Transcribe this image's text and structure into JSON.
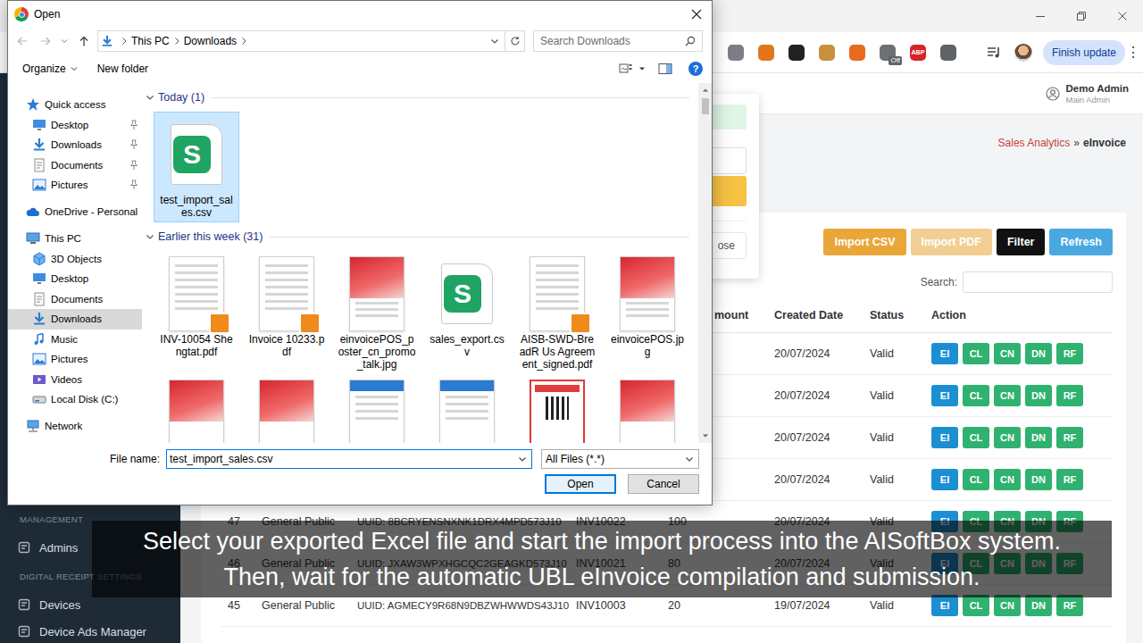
{
  "browser": {
    "extensions": [
      {
        "color": "#7b7f85"
      },
      {
        "color": "#e2761b"
      },
      {
        "color": "#222222"
      },
      {
        "color": "#c8913f"
      },
      {
        "color": "#e86a1d"
      },
      {
        "color": "#6d7075",
        "badge": "Off"
      },
      {
        "color": "#d8232a",
        "glyph": "ABP"
      },
      {
        "color": "#5f6368"
      }
    ],
    "update_button": "Finish update",
    "menu_glyph": "⋮"
  },
  "app": {
    "sidebar": {
      "items": [
        {
          "kind": "section",
          "label": "MANAGEMENT"
        },
        {
          "kind": "link",
          "label": "Admins"
        },
        {
          "kind": "section",
          "label": "DIGITAL RECEIPT SETTINGS"
        },
        {
          "kind": "link",
          "label": "Devices"
        },
        {
          "kind": "link",
          "label": "Device Ads Manager"
        }
      ]
    },
    "user": {
      "name": "Demo Admin",
      "role": "Main Admin"
    },
    "breadcrumb": {
      "parent": "Sales Analytics",
      "separator": "»",
      "current": "eInvoice"
    },
    "modal": {
      "close_label": "ose"
    },
    "actions": [
      {
        "label": "Import CSV",
        "disabled": false,
        "color": "#e9a73a"
      },
      {
        "label": "Import PDF",
        "disabled": true,
        "color": "#e9a73a"
      },
      {
        "label": "Filter",
        "disabled": false,
        "color": "#111111"
      },
      {
        "label": "Refresh",
        "disabled": false,
        "color": "#4aa8e0"
      }
    ],
    "search": {
      "label": "Search:",
      "value": ""
    },
    "table": {
      "columns": [
        "mount",
        "Created Date",
        "Status",
        "Action"
      ],
      "row_actions": [
        {
          "label": "EI",
          "color": "#1c8fd3"
        },
        {
          "label": "CL",
          "color": "#2fb170"
        },
        {
          "label": "CN",
          "color": "#2fb170"
        },
        {
          "label": "DN",
          "color": "#2fb170"
        },
        {
          "label": "RF",
          "color": "#2fb170"
        }
      ],
      "rows": [
        {
          "id": "",
          "customer": "",
          "uuid": "",
          "invoice": "",
          "amount": "",
          "date": "20/07/2024",
          "status": "Valid"
        },
        {
          "id": "",
          "customer": "",
          "uuid": "",
          "invoice": "",
          "amount": "",
          "date": "20/07/2024",
          "status": "Valid"
        },
        {
          "id": "",
          "customer": "",
          "uuid": "",
          "invoice": "",
          "amount": "",
          "date": "20/07/2024",
          "status": "Valid"
        },
        {
          "id": "",
          "customer": "",
          "uuid": "",
          "invoice": "",
          "amount": "",
          "date": "20/07/2024",
          "status": "Valid"
        },
        {
          "id": "47",
          "customer": "General Public",
          "uuid": "UUID: 8BCRYENSNXNK1DRX4MPD573J10",
          "invoice": "INV10022",
          "amount": "100",
          "date": "20/07/2024",
          "status": "Valid"
        },
        {
          "id": "46",
          "customer": "General Public",
          "uuid": "UUID: JXAW3WPXHGCQC2GEAGKD573J10",
          "invoice": "INV10021",
          "amount": "80",
          "date": "20/07/2024",
          "status": "Valid"
        },
        {
          "id": "45",
          "customer": "General Public",
          "uuid": "UUID: AGMECY9R68N9DBZWHWWDS43J10",
          "invoice": "INV10003",
          "amount": "20",
          "date": "19/07/2024",
          "status": "Valid"
        }
      ]
    }
  },
  "dialog": {
    "title": "Open",
    "path": [
      "This PC",
      "Downloads"
    ],
    "search_placeholder": "Search Downloads",
    "commands": [
      {
        "label": "Organize",
        "dropdown": true
      },
      {
        "label": "New folder",
        "dropdown": false
      }
    ],
    "help_glyph": "?",
    "nav": [
      {
        "label": "Quick access",
        "kind": "star",
        "selected": false,
        "children": [
          {
            "label": "Desktop",
            "kind": "desktop",
            "pinned": true,
            "selected": false
          },
          {
            "label": "Downloads",
            "kind": "downloads",
            "pinned": true,
            "selected": false
          },
          {
            "label": "Documents",
            "kind": "documents",
            "pinned": true,
            "selected": false
          },
          {
            "label": "Pictures",
            "kind": "pictures",
            "pinned": true,
            "selected": false
          }
        ]
      },
      {
        "label": "OneDrive - Personal",
        "kind": "cloud",
        "selected": false,
        "children": []
      },
      {
        "label": "This PC",
        "kind": "pc",
        "selected": false,
        "children": [
          {
            "label": "3D Objects",
            "kind": "objects",
            "pinned": false,
            "selected": false
          },
          {
            "label": "Desktop",
            "kind": "desktop",
            "pinned": false,
            "selected": false
          },
          {
            "label": "Documents",
            "kind": "documents",
            "pinned": false,
            "selected": false
          },
          {
            "label": "Downloads",
            "kind": "downloads",
            "pinned": false,
            "selected": true
          },
          {
            "label": "Music",
            "kind": "music",
            "pinned": false,
            "selected": false
          },
          {
            "label": "Pictures",
            "kind": "pictures",
            "pinned": false,
            "selected": false
          },
          {
            "label": "Videos",
            "kind": "videos",
            "pinned": false,
            "selected": false
          },
          {
            "label": "Local Disk (C:)",
            "kind": "disk",
            "pinned": false,
            "selected": false
          }
        ]
      },
      {
        "label": "Network",
        "kind": "network",
        "selected": false,
        "children": []
      }
    ],
    "groups": [
      {
        "label": "Today (1)",
        "expanded": true,
        "files": [
          {
            "name": "test_import_sales.csv",
            "kind": "csv",
            "glyph": "S",
            "selected": true
          }
        ],
        "clipped_thumbnails": []
      },
      {
        "label": "Earlier this week (31)",
        "expanded": true,
        "files": [
          {
            "name": "INV-10054 Shengtat.pdf",
            "kind": "pdf",
            "selected": false
          },
          {
            "name": "Invoice 10233.pdf",
            "kind": "pdf",
            "selected": false
          },
          {
            "name": "einvoicePOS_poster_cn_promo_talk.jpg",
            "kind": "poster",
            "selected": false
          },
          {
            "name": "sales_export.csv",
            "kind": "csv",
            "glyph": "S",
            "selected": false
          },
          {
            "name": "AISB-SWD-BreadR Us Agreement_signed.pdf",
            "kind": "pdf",
            "selected": false
          },
          {
            "name": "einvoicePOS.jpg",
            "kind": "poster",
            "selected": false
          }
        ],
        "clipped_thumbnails": [
          {
            "kind": "poster"
          },
          {
            "kind": "poster"
          },
          {
            "kind": "doc"
          },
          {
            "kind": "doc"
          },
          {
            "kind": "card"
          },
          {
            "kind": "poster"
          }
        ]
      }
    ],
    "file_name_label": "File name:",
    "file_name": "test_import_sales.csv",
    "file_type": "All Files (*.*)",
    "buttons": [
      {
        "label": "Open",
        "default": true
      },
      {
        "label": "Cancel",
        "default": false
      }
    ]
  },
  "subtitle": {
    "lines": [
      "Select your exported Excel file and start the import process into the AISoftBox system.",
      "Then, wait for the automatic UBL eInvoice compilation and submission."
    ]
  }
}
